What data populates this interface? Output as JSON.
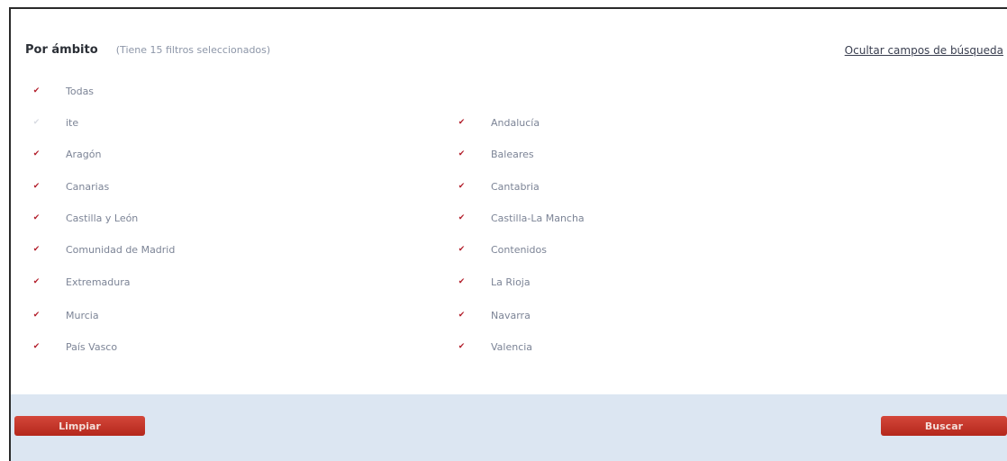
{
  "filter": {
    "title": "Por ámbito",
    "subtitle": "(Tiene 15 filtros seleccionados)",
    "hide_link": "Ocultar campos de búsqueda",
    "options": [
      {
        "label": "Todas",
        "checked": true
      },
      {
        "label": "ite",
        "checked": false
      },
      {
        "label": "Andalucía",
        "checked": true
      },
      {
        "label": "Aragón",
        "checked": true
      },
      {
        "label": "Baleares",
        "checked": true
      },
      {
        "label": "Canarias",
        "checked": true
      },
      {
        "label": "Cantabria",
        "checked": true
      },
      {
        "label": "Castilla y León",
        "checked": true
      },
      {
        "label": "Castilla-La Mancha",
        "checked": true
      },
      {
        "label": "Comunidad de Madrid",
        "checked": true
      },
      {
        "label": "Contenidos",
        "checked": true
      },
      {
        "label": "Extremadura",
        "checked": true
      },
      {
        "label": "La Rioja",
        "checked": true
      },
      {
        "label": "Murcia",
        "checked": true
      },
      {
        "label": "Navarra",
        "checked": true
      },
      {
        "label": "País Vasco",
        "checked": true
      },
      {
        "label": "Valencia",
        "checked": true
      }
    ]
  },
  "buttons": {
    "clear_label": "Limpiar",
    "search_label": "Buscar"
  },
  "colors": {
    "accent": "#c0392b",
    "footer_background": "#dce6f2"
  }
}
